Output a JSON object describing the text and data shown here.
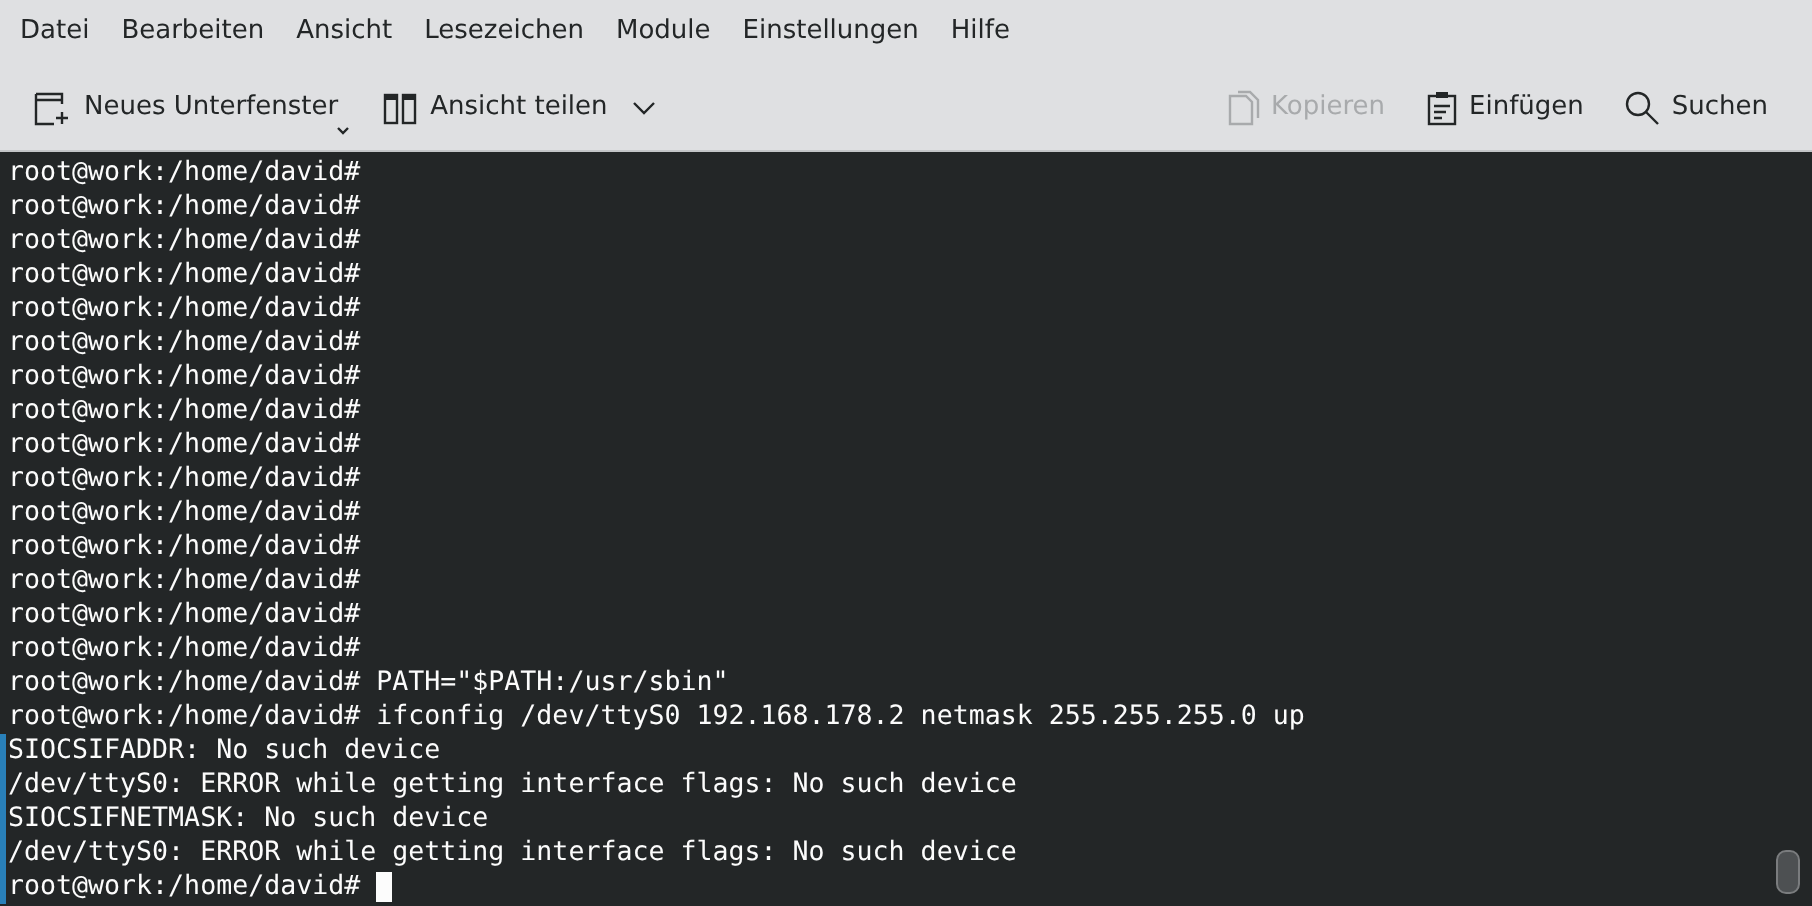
{
  "menu": [
    {
      "label": "Datei"
    },
    {
      "label": "Bearbeiten"
    },
    {
      "label": "Ansicht"
    },
    {
      "label": "Lesezeichen"
    },
    {
      "label": "Module"
    },
    {
      "label": "Einstellungen"
    },
    {
      "label": "Hilfe"
    }
  ],
  "toolbar_left": [
    {
      "label": "Neues Unterfenster",
      "disabled": false
    },
    {
      "label": "Ansicht teilen",
      "disabled": false
    }
  ],
  "toolbar_right": [
    {
      "label": "Kopieren",
      "disabled": true
    },
    {
      "label": "Einfügen",
      "disabled": false
    },
    {
      "label": "Suchen",
      "disabled": false
    }
  ],
  "terminal": {
    "lines": [
      {
        "kind": "prompt",
        "prompt": "root@work:/home/david#",
        "marked": false,
        "cursor": false
      },
      {
        "kind": "prompt",
        "prompt": "root@work:/home/david#",
        "marked": false,
        "cursor": false
      },
      {
        "kind": "prompt",
        "prompt": "root@work:/home/david#",
        "marked": false,
        "cursor": false
      },
      {
        "kind": "prompt",
        "prompt": "root@work:/home/david#",
        "marked": false,
        "cursor": false
      },
      {
        "kind": "prompt",
        "prompt": "root@work:/home/david#",
        "marked": false,
        "cursor": false
      },
      {
        "kind": "prompt",
        "prompt": "root@work:/home/david#",
        "marked": false,
        "cursor": false
      },
      {
        "kind": "prompt",
        "prompt": "root@work:/home/david#",
        "marked": false,
        "cursor": false
      },
      {
        "kind": "prompt",
        "prompt": "root@work:/home/david#",
        "marked": false,
        "cursor": false
      },
      {
        "kind": "prompt",
        "prompt": "root@work:/home/david#",
        "marked": false,
        "cursor": false
      },
      {
        "kind": "prompt",
        "prompt": "root@work:/home/david#",
        "marked": false,
        "cursor": false
      },
      {
        "kind": "prompt",
        "prompt": "root@work:/home/david#",
        "marked": false,
        "cursor": false
      },
      {
        "kind": "prompt",
        "prompt": "root@work:/home/david#",
        "marked": false,
        "cursor": false
      },
      {
        "kind": "prompt",
        "prompt": "root@work:/home/david#",
        "marked": false,
        "cursor": false
      },
      {
        "kind": "prompt",
        "prompt": "root@work:/home/david#",
        "marked": false,
        "cursor": false
      },
      {
        "kind": "prompt",
        "prompt": "root@work:/home/david#",
        "marked": false,
        "cursor": false
      },
      {
        "kind": "prompt",
        "prompt": "root@work:/home/david#",
        "command": "PATH=\"$PATH:/usr/sbin\"",
        "marked": false,
        "cursor": false
      },
      {
        "kind": "prompt",
        "prompt": "root@work:/home/david#",
        "command": "ifconfig /dev/ttyS0 192.168.178.2 netmask 255.255.255.0 up",
        "marked": false,
        "cursor": false
      },
      {
        "kind": "output",
        "text": "SIOCSIFADDR: No such device",
        "marked": true,
        "cursor": false
      },
      {
        "kind": "output",
        "text": "/dev/ttyS0: ERROR while getting interface flags: No such device",
        "marked": true,
        "cursor": false
      },
      {
        "kind": "output",
        "text": "SIOCSIFNETMASK: No such device",
        "marked": true,
        "cursor": false
      },
      {
        "kind": "output",
        "text": "/dev/ttyS0: ERROR while getting interface flags: No such device",
        "marked": true,
        "cursor": false
      },
      {
        "kind": "prompt",
        "prompt": "root@work:/home/david#",
        "marked": true,
        "cursor": true
      }
    ]
  }
}
